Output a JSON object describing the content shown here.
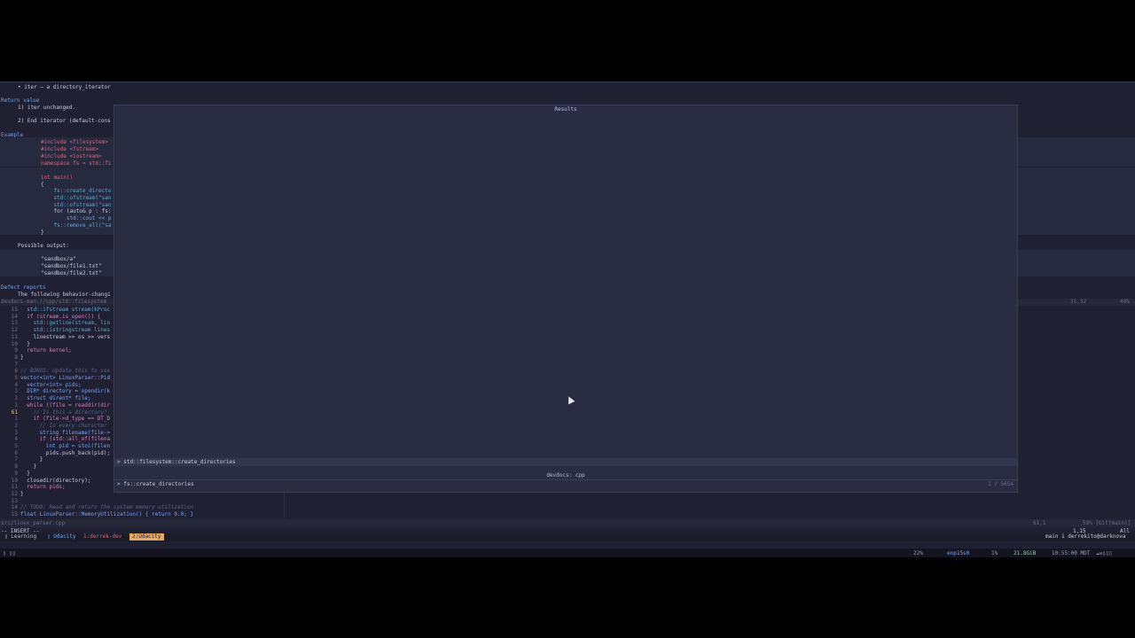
{
  "doc": {
    "param_line": "• iter — a directory_iterator",
    "return_heading": "Return value",
    "ret1": "1) iter unchanged.",
    "ret2": "2) End iterator (default-cons",
    "example_heading": "Example",
    "code": [
      "#include <filesystem>",
      "#include <fstream>",
      "#include <iostream>",
      "namespace fs = std::fi",
      "",
      "int main()",
      "{",
      "    fs::create_directo",
      "    std::ofstream(\"san",
      "    std::ofstream(\"san",
      "    for (auto& p : fs:",
      "        std::cout << p",
      "    fs::remove_all(\"sa",
      "}"
    ],
    "possible_output": "Possible output:",
    "output": [
      "\"sandbox/a\"",
      "\"sandbox/file1.txt\"",
      "\"sandbox/file2.txt\""
    ],
    "defect_heading": "Defect reports",
    "defect_text": "The following behavior-changi"
  },
  "status1": {
    "left": "devdocs-man://cpp/std::filesystem",
    "pos": "31,32",
    "pct": "48%"
  },
  "code": {
    "lines": [
      {
        "n": "15",
        "t": "  std::ifstream stream(kProc"
      },
      {
        "n": "14",
        "t": "  if (stream.is_open()) {"
      },
      {
        "n": "13",
        "t": "    std::getline(stream, lin"
      },
      {
        "n": "12",
        "t": "    std::istringstream lines"
      },
      {
        "n": "11",
        "t": "    linestream >> os >> vers"
      },
      {
        "n": "10",
        "t": "  }"
      },
      {
        "n": "9",
        "t": "  return kernel;"
      },
      {
        "n": "8",
        "t": "}"
      },
      {
        "n": "7",
        "t": ""
      },
      {
        "n": "6",
        "t": "// BONUS: Update this to use"
      },
      {
        "n": "5",
        "t": "vector<int> LinuxParser::Pid"
      },
      {
        "n": "4",
        "t": "  vector<int> pids;"
      },
      {
        "n": "3",
        "t": "  DIR* directory = opendir(k"
      },
      {
        "n": "2",
        "t": "  struct dirent* file;"
      },
      {
        "n": "1",
        "t": "  while ((file = readdir(dir"
      },
      {
        "n": "61",
        "t": "    // Is this a directory?"
      },
      {
        "n": "1",
        "t": "    if (file->d_type == DT_D"
      },
      {
        "n": "2",
        "t": "      // Is every character"
      },
      {
        "n": "3",
        "t": "      string filename(file->"
      },
      {
        "n": "4",
        "t": "      if (std::all_of(filena"
      },
      {
        "n": "5",
        "t": "        int pid = stoi(filen"
      },
      {
        "n": "6",
        "t": "        pids.push_back(pid);"
      },
      {
        "n": "7",
        "t": "      }"
      },
      {
        "n": "8",
        "t": "    }"
      },
      {
        "n": "9",
        "t": "  }"
      },
      {
        "n": "10",
        "t": "  closedir(directory);"
      },
      {
        "n": "11",
        "t": "  return pids;"
      },
      {
        "n": "12",
        "t": "}"
      },
      {
        "n": "13",
        "t": ""
      },
      {
        "n": "14",
        "t": "// TODO: Read and return the system memory utilization"
      },
      {
        "n": "15",
        "t": "float LinuxParser::MemoryUtilization() { return 0.0; }"
      }
    ]
  },
  "status2": {
    "file": "src/linux_parser.cpp",
    "pos": "61,1",
    "right": "58% [Git(main)]"
  },
  "mode": {
    "label": "-- INSERT --",
    "pos": "1,15",
    "all": "All",
    "session": "main 1 derrekito@darknova"
  },
  "tmux": {
    "session": "Learning",
    "tabs": [
      "Udacity",
      "1:derrek-dev",
      "2:Udacity"
    ]
  },
  "waybar": {
    "left": "▯ ▯▯",
    "cpu": "22%",
    "net": "enp15s0",
    "load": "1%",
    "mem": "21.8GiB",
    "clock": "10:55:00 MDT"
  },
  "picker": {
    "title": "Results",
    "selected": "> std::filesystem::create_directories",
    "prompt_title": "devdocs: cpp",
    "prompt": "> fs::create_directories",
    "count": "1 / 5654"
  }
}
